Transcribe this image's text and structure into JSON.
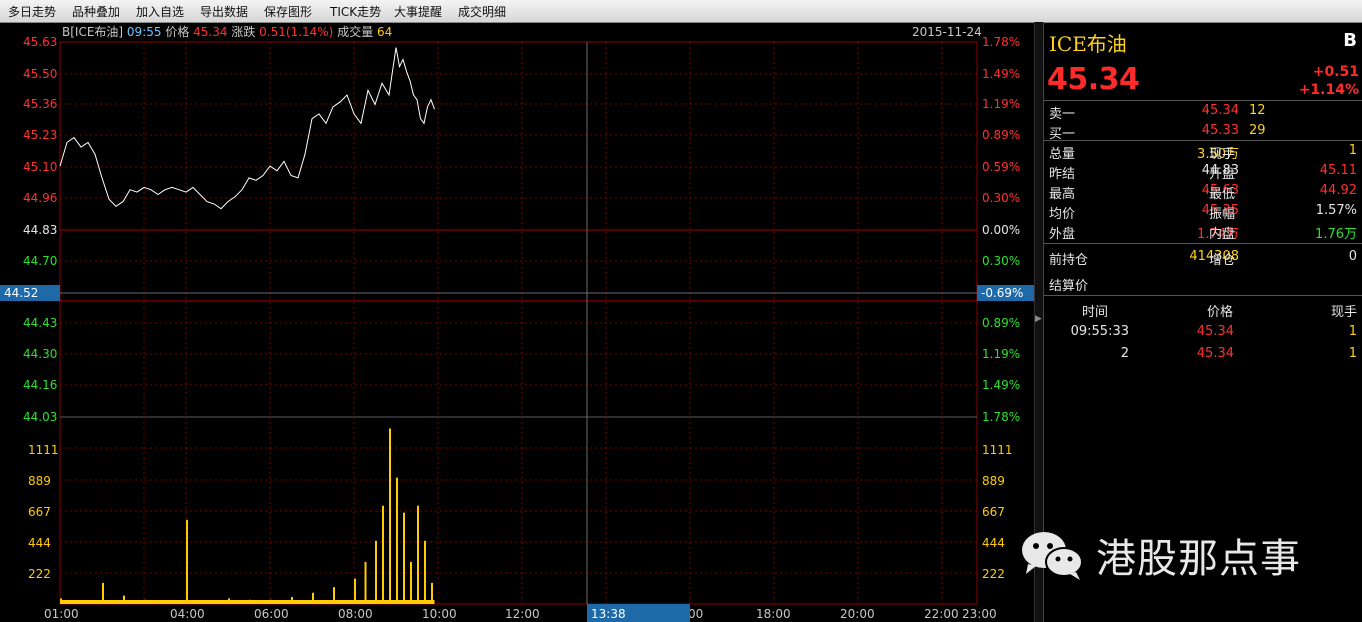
{
  "menu": [
    "多日走势",
    "品种叠加",
    "加入自选",
    "导出数据",
    "保存图形",
    "TICK走势",
    "大事提醒",
    "成交明细"
  ],
  "header": {
    "symbol": "B[ICE布油]",
    "time": "09:55",
    "price_label": "价格",
    "price": "45.34",
    "change_label": "涨跌",
    "change": "0.51(1.14%)",
    "volume_label": "成交量",
    "volume": "64",
    "date": "2015-11-24"
  },
  "price_axis": {
    "left": [
      {
        "v": "45.63",
        "c": "#ff3030"
      },
      {
        "v": "45.50",
        "c": "#ff3030"
      },
      {
        "v": "45.36",
        "c": "#ff3030"
      },
      {
        "v": "45.23",
        "c": "#ff3030"
      },
      {
        "v": "45.10",
        "c": "#ff3030"
      },
      {
        "v": "44.96",
        "c": "#ff3030"
      },
      {
        "v": "44.83",
        "c": "#e6e6e6"
      },
      {
        "v": "44.70",
        "c": "#2ce02c"
      },
      {
        "v": "44.43",
        "c": "#2ce02c"
      },
      {
        "v": "44.30",
        "c": "#2ce02c"
      },
      {
        "v": "44.16",
        "c": "#2ce02c"
      },
      {
        "v": "44.03",
        "c": "#2ce02c"
      }
    ],
    "right": [
      {
        "v": "1.78%",
        "c": "#ff3030"
      },
      {
        "v": "1.49%",
        "c": "#ff3030"
      },
      {
        "v": "1.19%",
        "c": "#ff3030"
      },
      {
        "v": "0.89%",
        "c": "#ff3030"
      },
      {
        "v": "0.59%",
        "c": "#ff3030"
      },
      {
        "v": "0.30%",
        "c": "#ff3030"
      },
      {
        "v": "0.00%",
        "c": "#e6e6e6"
      },
      {
        "v": "0.30%",
        "c": "#2ce02c"
      },
      {
        "v": "0.89%",
        "c": "#2ce02c"
      },
      {
        "v": "1.19%",
        "c": "#2ce02c"
      },
      {
        "v": "1.49%",
        "c": "#2ce02c"
      },
      {
        "v": "1.78%",
        "c": "#2ce02c"
      }
    ],
    "crosshair_left": "44.52",
    "crosshair_right": "-0.69%"
  },
  "volume_axis": [
    "1111",
    "889",
    "667",
    "444",
    "222"
  ],
  "time_axis": [
    "01:00",
    "04:00",
    "06:00",
    "08:00",
    "10:00",
    "12:00",
    "00",
    "18:00",
    "20:00",
    "22:00",
    "23:00"
  ],
  "crosshair_time": "13:38",
  "chart_data": {
    "type": "line",
    "x_range": [
      "01:00",
      "23:00"
    ],
    "ylim": [
      44.03,
      45.63
    ],
    "series": [
      {
        "x": [
          "01:00",
          "01:10",
          "01:20",
          "01:30",
          "01:40",
          "01:50",
          "02:00",
          "02:10",
          "02:20",
          "02:30",
          "02:40",
          "02:50",
          "03:00",
          "03:10",
          "03:20",
          "03:30",
          "03:40",
          "03:50",
          "04:00",
          "04:10",
          "04:20",
          "04:30",
          "04:40",
          "04:50",
          "05:00",
          "05:10",
          "05:20",
          "05:30",
          "05:40",
          "05:50",
          "06:00",
          "06:10",
          "06:20",
          "06:30",
          "06:40",
          "06:50",
          "07:00",
          "07:10",
          "07:20",
          "07:30",
          "07:40",
          "07:50",
          "08:00",
          "08:10",
          "08:20",
          "08:30",
          "08:40",
          "08:50",
          "09:00",
          "09:05",
          "09:10",
          "09:15",
          "09:20",
          "09:25",
          "09:30",
          "09:35",
          "09:40",
          "09:45",
          "09:50",
          "09:55"
        ],
        "values": [
          45.1,
          45.2,
          45.22,
          45.18,
          45.2,
          45.15,
          45.05,
          44.96,
          44.93,
          44.95,
          45.0,
          44.99,
          45.01,
          45.0,
          44.98,
          45.0,
          45.01,
          45.0,
          44.99,
          45.01,
          44.98,
          44.95,
          44.94,
          44.92,
          44.95,
          44.97,
          45.0,
          45.05,
          45.04,
          45.06,
          45.1,
          45.08,
          45.12,
          45.06,
          45.05,
          45.15,
          45.3,
          45.32,
          45.28,
          45.35,
          45.37,
          45.4,
          45.32,
          45.28,
          45.42,
          45.36,
          45.45,
          45.4,
          45.6,
          45.52,
          45.55,
          45.5,
          45.46,
          45.4,
          45.38,
          45.3,
          45.28,
          45.35,
          45.38,
          45.34
        ]
      }
    ],
    "volume": {
      "categories": [
        "01:00",
        "01:30",
        "02:00",
        "02:30",
        "03:00",
        "03:30",
        "04:00",
        "04:30",
        "05:00",
        "05:30",
        "06:00",
        "06:30",
        "07:00",
        "07:30",
        "08:00",
        "08:15",
        "08:30",
        "08:40",
        "08:50",
        "09:00",
        "09:10",
        "09:20",
        "09:30",
        "09:40",
        "09:50"
      ],
      "values": [
        40,
        20,
        150,
        60,
        30,
        20,
        600,
        20,
        40,
        30,
        30,
        50,
        80,
        120,
        180,
        300,
        450,
        700,
        1250,
        900,
        650,
        300,
        700,
        450,
        150
      ]
    }
  },
  "panel": {
    "title": "ICE布油",
    "badge": "B",
    "price": "45.34",
    "change": "+0.51",
    "change_pct": "+1.14%",
    "ask_label": "卖一",
    "ask_price": "45.34",
    "ask_vol": "12",
    "bid_label": "买一",
    "bid_price": "45.33",
    "bid_vol": "29",
    "stats": [
      {
        "l1": "总量",
        "v1": "3.50万",
        "c1": "#ffd21f",
        "l2": "现手",
        "v2": "1",
        "c2": "#ffd21f"
      },
      {
        "l1": "昨结",
        "v1": "44.83",
        "c1": "#e6e6e6",
        "l2": "开盘",
        "v2": "45.11",
        "c2": "#ff3030"
      },
      {
        "l1": "最高",
        "v1": "45.63",
        "c1": "#ff3030",
        "l2": "最低",
        "v2": "44.92",
        "c2": "#ff3030"
      },
      {
        "l1": "均价",
        "v1": "45.35",
        "c1": "#ff3030",
        "l2": "振幅",
        "v2": "1.57%",
        "c2": "#e6e6e6"
      },
      {
        "l1": "外盘",
        "v1": "1.74万",
        "c1": "#ff3030",
        "l2": "内盘",
        "v2": "1.76万",
        "c2": "#2ce02c"
      }
    ],
    "oi_label": "前持仓",
    "oi_value": "414308",
    "oi_inc_label": "增仓",
    "oi_inc_value": "0",
    "settle_label": "结算价",
    "ticks_header": {
      "time": "时间",
      "price": "价格",
      "vol": "现手"
    },
    "ticks": [
      {
        "time": "09:55:33",
        "price": "45.34",
        "vol": "1"
      },
      {
        "time": "2",
        "price": "45.34",
        "vol": "1"
      }
    ]
  },
  "watermark": "港股那点事",
  "colors": {
    "up": "#ff3030",
    "down": "#2ce02c",
    "grid": "#7a0000",
    "volume": "#ffcc00",
    "crosshair_box": "#1e6aa8"
  }
}
